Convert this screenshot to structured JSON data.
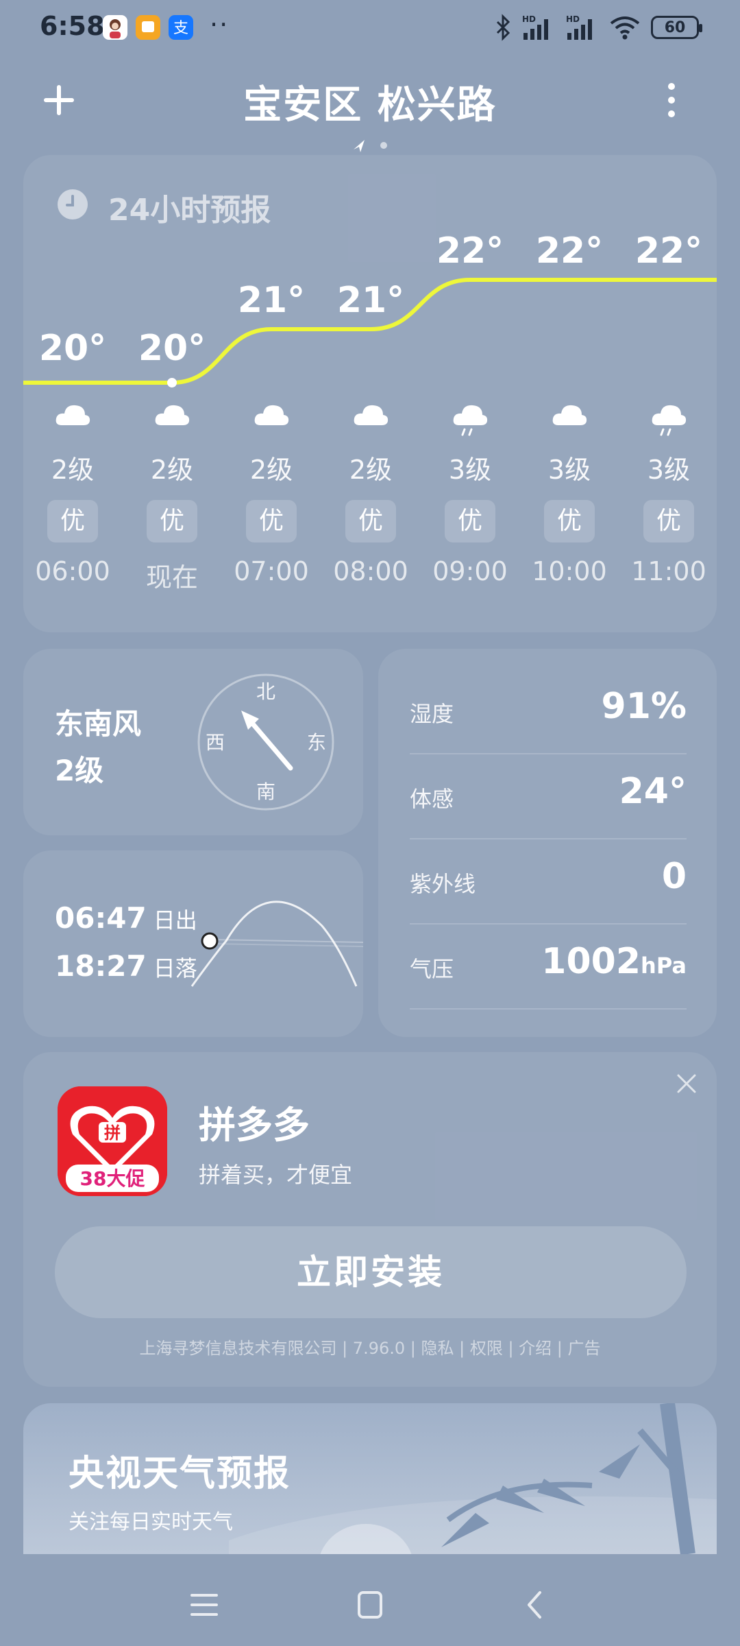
{
  "status_bar": {
    "time": "6:58",
    "dots": "··",
    "battery": "60",
    "signal_labels": [
      "HD",
      "HD"
    ],
    "colors": {
      "icon": "#1f2a3a"
    }
  },
  "header": {
    "location": "宝安区 松兴路",
    "add_icon": "plus-icon",
    "menu_icon": "more-vertical-icon"
  },
  "forecast": {
    "title": "24小时预报",
    "temp_line_color": "#eef73a",
    "hours": [
      {
        "time": "06:00",
        "temp": "20°",
        "temp_value": 20,
        "weather": "cloudy",
        "wind": "2级",
        "aqi": "优"
      },
      {
        "time": "现在",
        "temp": "20°",
        "temp_value": 20,
        "weather": "cloudy",
        "wind": "2级",
        "aqi": "优"
      },
      {
        "time": "07:00",
        "temp": "21°",
        "temp_value": 21,
        "weather": "cloudy",
        "wind": "2级",
        "aqi": "优"
      },
      {
        "time": "08:00",
        "temp": "21°",
        "temp_value": 21,
        "weather": "cloudy",
        "wind": "2级",
        "aqi": "优"
      },
      {
        "time": "09:00",
        "temp": "22°",
        "temp_value": 22,
        "weather": "light-rain",
        "wind": "3级",
        "aqi": "优"
      },
      {
        "time": "10:00",
        "temp": "22°",
        "temp_value": 22,
        "weather": "cloudy",
        "wind": "3级",
        "aqi": "优"
      },
      {
        "time": "11:00",
        "temp": "22°",
        "temp_value": 22,
        "weather": "light-rain",
        "wind": "3级",
        "aqi": "优"
      }
    ]
  },
  "wind": {
    "direction": "东南风",
    "level": "2级",
    "compass": {
      "north": "北",
      "south": "南",
      "east": "东",
      "west": "西"
    }
  },
  "sun": {
    "sunrise_time": "06:47",
    "sunrise_label": "日出",
    "sunset_time": "18:27",
    "sunset_label": "日落"
  },
  "details": [
    {
      "label": "湿度",
      "value": "91%",
      "unit": ""
    },
    {
      "label": "体感",
      "value": "24°",
      "unit": ""
    },
    {
      "label": "紫外线",
      "value": "0",
      "unit": ""
    },
    {
      "label": "气压",
      "value": "1002",
      "unit": "hPa"
    }
  ],
  "ad": {
    "app_name": "拼多多",
    "slogan": "拼着买，才便宜",
    "icon_badge": "38大促",
    "icon_char": "拼",
    "install_button": "立即安装",
    "meta": "上海寻梦信息技术有限公司  |  7.96.0  |  隐私  |  权限  |  介绍  |  广告",
    "colors": {
      "brand": "#e8212b",
      "badge_text": "#e0217a"
    }
  },
  "cctv": {
    "title": "央视天气预报",
    "subtitle": "关注每日实时天气"
  },
  "nav": {
    "menu_icon": "menu-icon",
    "home_icon": "home-icon",
    "back_icon": "back-icon"
  }
}
